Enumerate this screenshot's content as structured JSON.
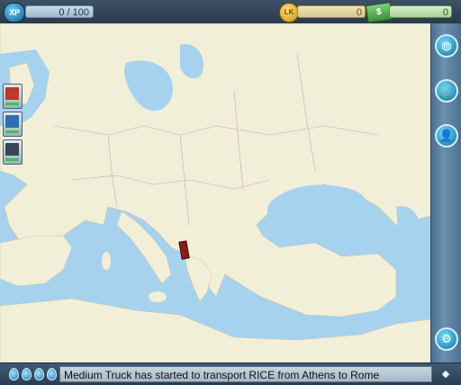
{
  "topbar": {
    "xp_label": "XP",
    "xp_value": "0 / 100",
    "coin_label": "LK",
    "coins_value": "0",
    "cash_label": "$",
    "cash_value": "0"
  },
  "sidebar": {
    "buttons": [
      {
        "name": "world-map",
        "icon": "globe-icon",
        "glyph": "◍"
      },
      {
        "name": "shop",
        "icon": "cart-icon",
        "glyph": "🛒"
      },
      {
        "name": "profile",
        "icon": "person-icon",
        "glyph": "👤"
      },
      {
        "name": "settings",
        "icon": "gear-icon",
        "glyph": "⚙"
      }
    ]
  },
  "trucks": [
    {
      "name": "truck-1"
    },
    {
      "name": "truck-2"
    },
    {
      "name": "truck-3"
    }
  ],
  "message_bar": {
    "message": "Medium Truck has started to transport RICE from Athens to Rome",
    "expand_glyph": "◆"
  },
  "colors": {
    "sea": "#a6d2ee",
    "land": "#f2efd9",
    "accent": "#0d6f9a"
  }
}
